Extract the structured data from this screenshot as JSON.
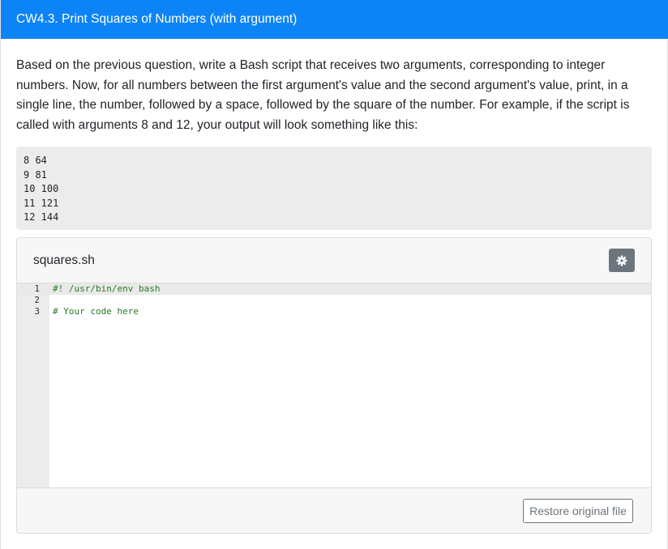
{
  "header": {
    "title": "CW4.3. Print Squares of Numbers (with argument)"
  },
  "description": "Based on the previous question, write a Bash script that receives two arguments, corresponding to integer numbers. Now, for all numbers between the first argument's value and the second argument's value, print, in a single line, the number, followed by a space, followed by the square of the number. For example, if the script is called with arguments 8 and 12, your output will look something like this:",
  "example_output": [
    "8 64",
    "9 81",
    "10 100",
    "11 121",
    "12 144"
  ],
  "editor": {
    "file_name": "squares.sh",
    "settings_icon": "gear-icon",
    "line_numbers": [
      "1",
      "2",
      "3"
    ],
    "code_lines": [
      "#! /usr/bin/env bash",
      "",
      "# Your code here"
    ],
    "restore_label": "Restore original file"
  },
  "colors": {
    "header_bg": "#0d84f5",
    "settings_button_bg": "#6c757d",
    "comment_text": "#2a7a2a"
  }
}
